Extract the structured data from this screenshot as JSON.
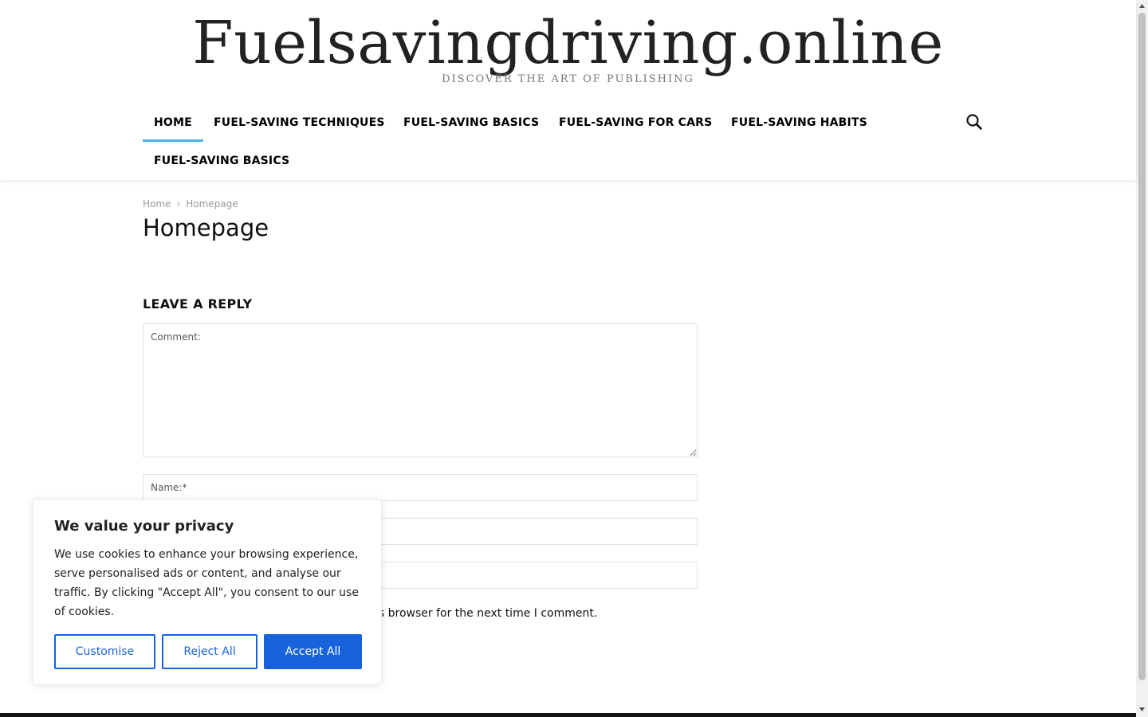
{
  "header": {
    "site_title": "Fuelsavingdriving.online",
    "tagline": "DISCOVER THE ART OF PUBLISHING",
    "nav": [
      {
        "label": "HOME",
        "active": true
      },
      {
        "label": "FUEL-SAVING TECHNIQUES",
        "active": false
      },
      {
        "label": "FUEL-SAVING BASICS",
        "active": false
      },
      {
        "label": "FUEL-SAVING FOR CARS",
        "active": false
      },
      {
        "label": "FUEL-SAVING HABITS",
        "active": false
      },
      {
        "label": "FUEL-SAVING BASICS",
        "active": false
      }
    ],
    "search_icon": "search-icon"
  },
  "main": {
    "breadcrumb": {
      "home": "Home",
      "separator": "›",
      "current": "Homepage"
    },
    "page_title": "Homepage",
    "reply": {
      "title": "LEAVE A REPLY",
      "comment_placeholder": "Comment:",
      "name_placeholder": "Name:*",
      "email_placeholder": "",
      "website_placeholder": "",
      "save_info_visible": "is browser for the next time I comment."
    }
  },
  "cookie_banner": {
    "title": "We value your privacy",
    "text": "We use cookies to enhance your browsing experience, serve personalised ads or content, and analyse our traffic. By clicking \"Accept All\", you consent to our use of cookies.",
    "customise_label": "Customise",
    "reject_label": "Reject All",
    "accept_label": "Accept All"
  },
  "colors": {
    "accent": "#4db2ec",
    "cookie_button": "#1863dc",
    "footer": "#111111"
  }
}
